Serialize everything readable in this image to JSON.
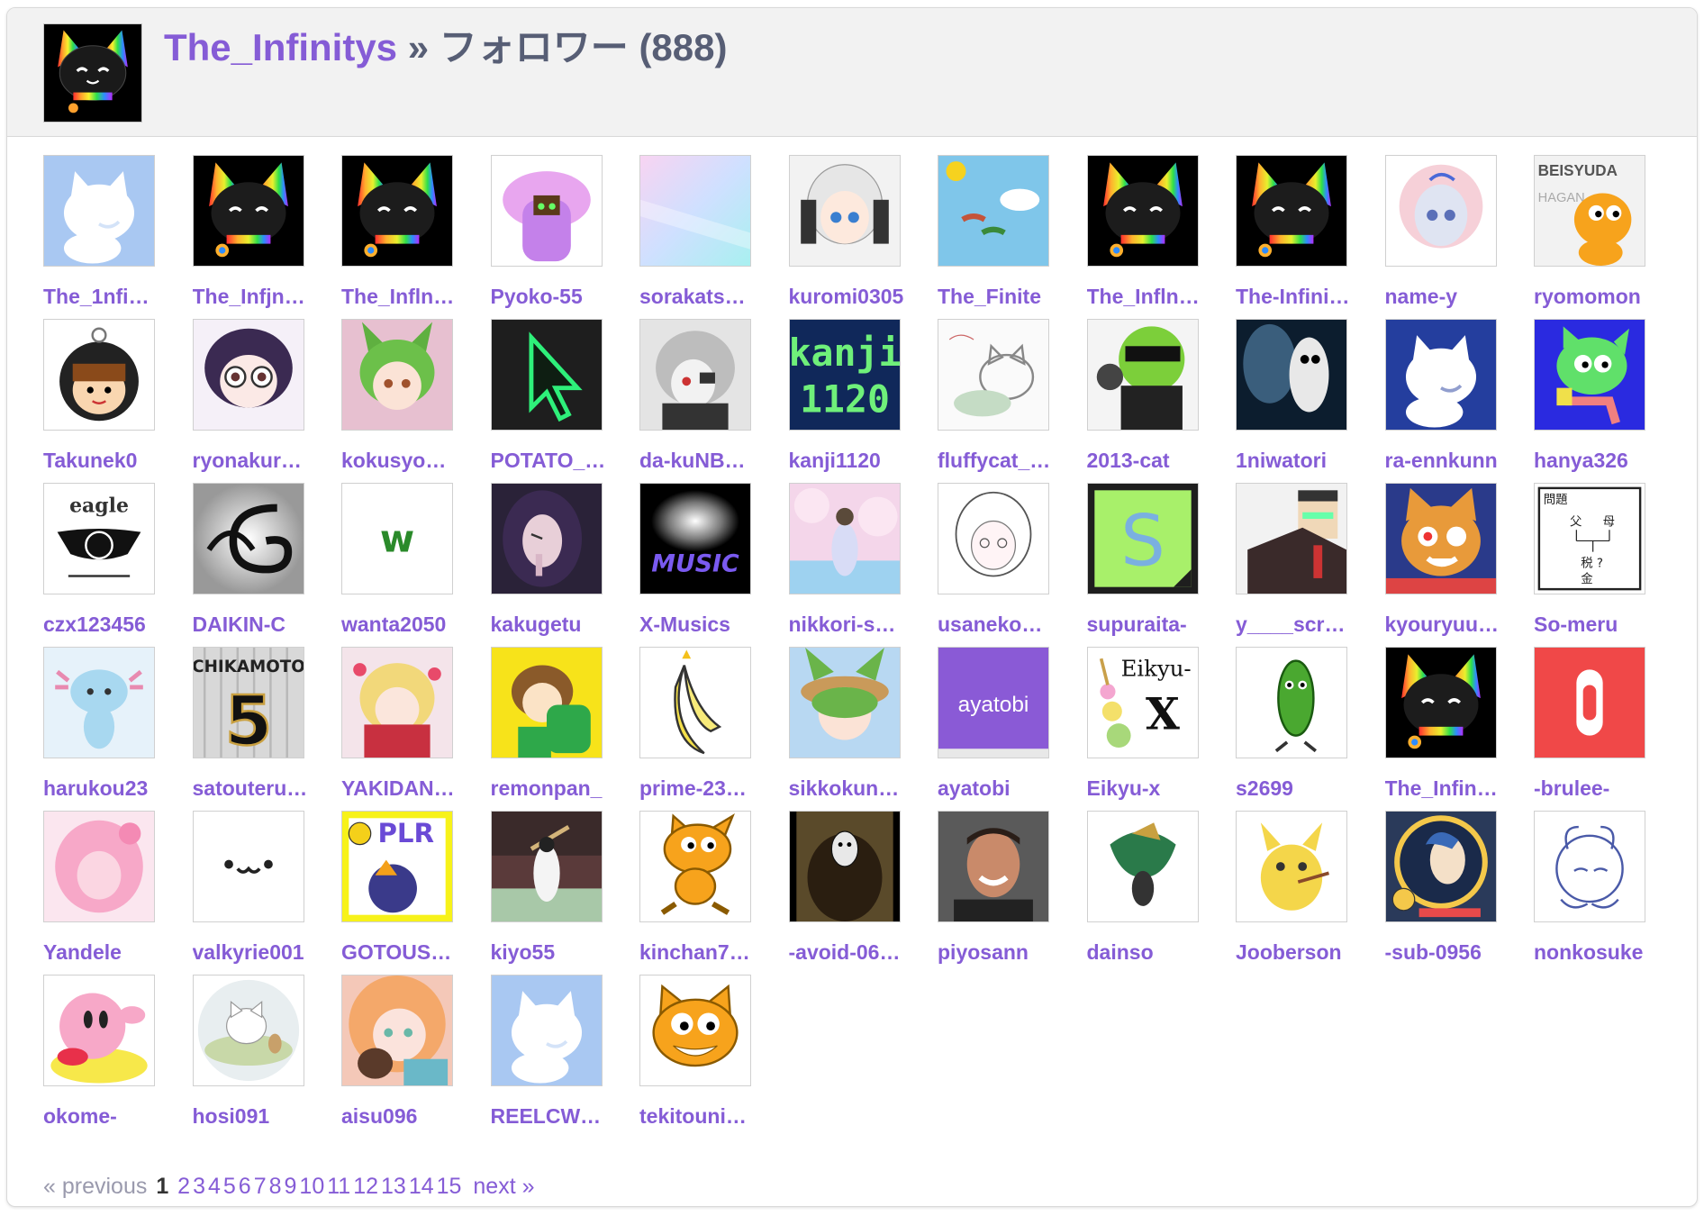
{
  "header": {
    "owner": "The_Infinitys",
    "separator": "»",
    "section": "フォロワー",
    "count": "(888)"
  },
  "users": [
    {
      "name": "The_1nfi…",
      "avatar": "scratch-cat-default-icon"
    },
    {
      "name": "The_Infjn…",
      "avatar": "black-rainbow-cat-icon"
    },
    {
      "name": "The_Infln…",
      "avatar": "black-rainbow-cat-icon"
    },
    {
      "name": "Pyoko-55",
      "avatar": "purple-hooded-character-icon"
    },
    {
      "name": "sorakats…",
      "avatar": "pastel-gradient-icon"
    },
    {
      "name": "kuromi0305",
      "avatar": "anime-white-hair-girl-icon"
    },
    {
      "name": "The_Finite",
      "avatar": "sky-landscape-icon"
    },
    {
      "name": "The_Infln…",
      "avatar": "black-rainbow-cat-icon"
    },
    {
      "name": "The-Infini…",
      "avatar": "black-rainbow-cat-icon"
    },
    {
      "name": "name-y",
      "avatar": "anime-silver-hair-girl-icon"
    },
    {
      "name": "ryomomon",
      "avatar": "scratch-cat-meme-icon"
    },
    {
      "name": "Takunek0",
      "avatar": "hooded-boy-icon"
    },
    {
      "name": "ryonakur…",
      "avatar": "anime-glasses-girl-icon"
    },
    {
      "name": "kokusyo…",
      "avatar": "anime-green-hair-girl-icon"
    },
    {
      "name": "POTATO_…",
      "avatar": "green-cursor-icon"
    },
    {
      "name": "da-kuNB…",
      "avatar": "anime-grey-girl-icon"
    },
    {
      "name": "kanji1120",
      "avatar": "kanji1120-text-icon"
    },
    {
      "name": "fluffycat_…",
      "avatar": "sketch-cat-icon"
    },
    {
      "name": "2013-cat",
      "avatar": "sunglasses-character-icon"
    },
    {
      "name": "1niwatori",
      "avatar": "dark-skeleton-icon"
    },
    {
      "name": "ra-ennkunn",
      "avatar": "scratch-cat-blue-icon"
    },
    {
      "name": "hanya326",
      "avatar": "green-scratch-cat-icon"
    },
    {
      "name": "czx123456",
      "avatar": "eagle-emblem-icon"
    },
    {
      "name": "DAIKIN-C",
      "avatar": "dragon-emblem-icon"
    },
    {
      "name": "wanta2050",
      "avatar": "green-w-icon"
    },
    {
      "name": "kakugetu",
      "avatar": "anime-dark-girl-icon"
    },
    {
      "name": "X-Musics",
      "avatar": "music-logo-icon"
    },
    {
      "name": "nikkori-s…",
      "avatar": "cherry-blossom-girl-icon"
    },
    {
      "name": "usaneko…",
      "avatar": "line-drawing-girl-icon"
    },
    {
      "name": "supuraita-",
      "avatar": "letter-s-icon"
    },
    {
      "name": "y____scr…",
      "avatar": "pixel-man-icon"
    },
    {
      "name": "kyouryuu…",
      "avatar": "orange-cat-robot-icon"
    },
    {
      "name": "So-meru",
      "avatar": "quiz-diagram-icon"
    },
    {
      "name": "harukou23",
      "avatar": "axolotl-icon"
    },
    {
      "name": "satouteru…",
      "avatar": "jersey-5-icon"
    },
    {
      "name": "YAKIDAN…",
      "avatar": "anime-blonde-girl-icon"
    },
    {
      "name": "remonpan_",
      "avatar": "anime-boy-yellow-icon"
    },
    {
      "name": "prime-23…",
      "avatar": "banana-icon"
    },
    {
      "name": "sikkokun…",
      "avatar": "anime-hat-girl-icon"
    },
    {
      "name": "ayatobi",
      "avatar": "ayatobi-text-icon"
    },
    {
      "name": "Eikyu-x",
      "avatar": "eikyu-x-text-icon"
    },
    {
      "name": "s2699",
      "avatar": "cucumber-icon"
    },
    {
      "name": "The_Infin…",
      "avatar": "black-rainbow-cat-icon"
    },
    {
      "name": "-brulee-",
      "avatar": "red-toggle-icon"
    },
    {
      "name": "Yandele",
      "avatar": "pink-hair-girl-icon"
    },
    {
      "name": "valkyrie001",
      "avatar": "kaomoji-face-icon"
    },
    {
      "name": "GOTOUS…",
      "avatar": "plr-character-icon"
    },
    {
      "name": "kiyo55",
      "avatar": "baseball-batter-icon"
    },
    {
      "name": "kinchan7…",
      "avatar": "scratch-cat-icon"
    },
    {
      "name": "-avoid-06…",
      "avatar": "mona-lisa-icon"
    },
    {
      "name": "piyosann",
      "avatar": "smiling-man-photo-icon"
    },
    {
      "name": "dainso",
      "avatar": "green-creature-icon"
    },
    {
      "name": "Jooberson",
      "avatar": "yellow-pokemon-icon"
    },
    {
      "name": "-sub-0956",
      "avatar": "pearl-earring-badge-icon"
    },
    {
      "name": "nonkosuke",
      "avatar": "sketch-character-icon"
    },
    {
      "name": "okome-",
      "avatar": "kirby-icon"
    },
    {
      "name": "hosi091",
      "avatar": "white-cat-walking-icon"
    },
    {
      "name": "aisu096",
      "avatar": "anime-orange-hair-girl-icon"
    },
    {
      "name": "REELCW…",
      "avatar": "scratch-cat-default-icon"
    },
    {
      "name": "tekitouni…",
      "avatar": "scratch-cat-face-icon"
    }
  ],
  "pagination": {
    "previous": "« previous",
    "current": "1",
    "pages": [
      "2",
      "3",
      "4",
      "5",
      "6",
      "7",
      "8",
      "9",
      "10",
      "11",
      "12",
      "13",
      "14",
      "15"
    ],
    "next": "next »"
  },
  "colors": {
    "link": "#855cd6",
    "heading": "#575e75",
    "header_bg": "#f2f2f2"
  }
}
